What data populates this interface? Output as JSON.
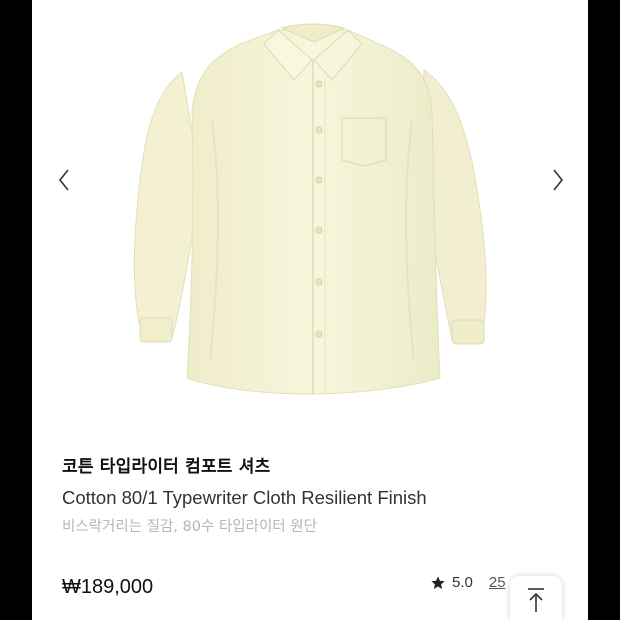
{
  "product": {
    "name_ko": "코튼 타입라이터 컴포트 셔츠",
    "name_en": "Cotton 80/1 Typewriter Cloth Resilient Finish",
    "description": "비스락거리는 질감, 80수 타입라이터 원단",
    "price": "₩189,000",
    "rating": "5.0",
    "review_count": "25"
  },
  "colors": {
    "shirt": "#f6f4d8",
    "text_primary": "#111111",
    "text_muted": "#b5b5b5"
  },
  "icons": [
    "chevron-left-icon",
    "chevron-right-icon",
    "star-icon",
    "arrow-up-icon"
  ]
}
